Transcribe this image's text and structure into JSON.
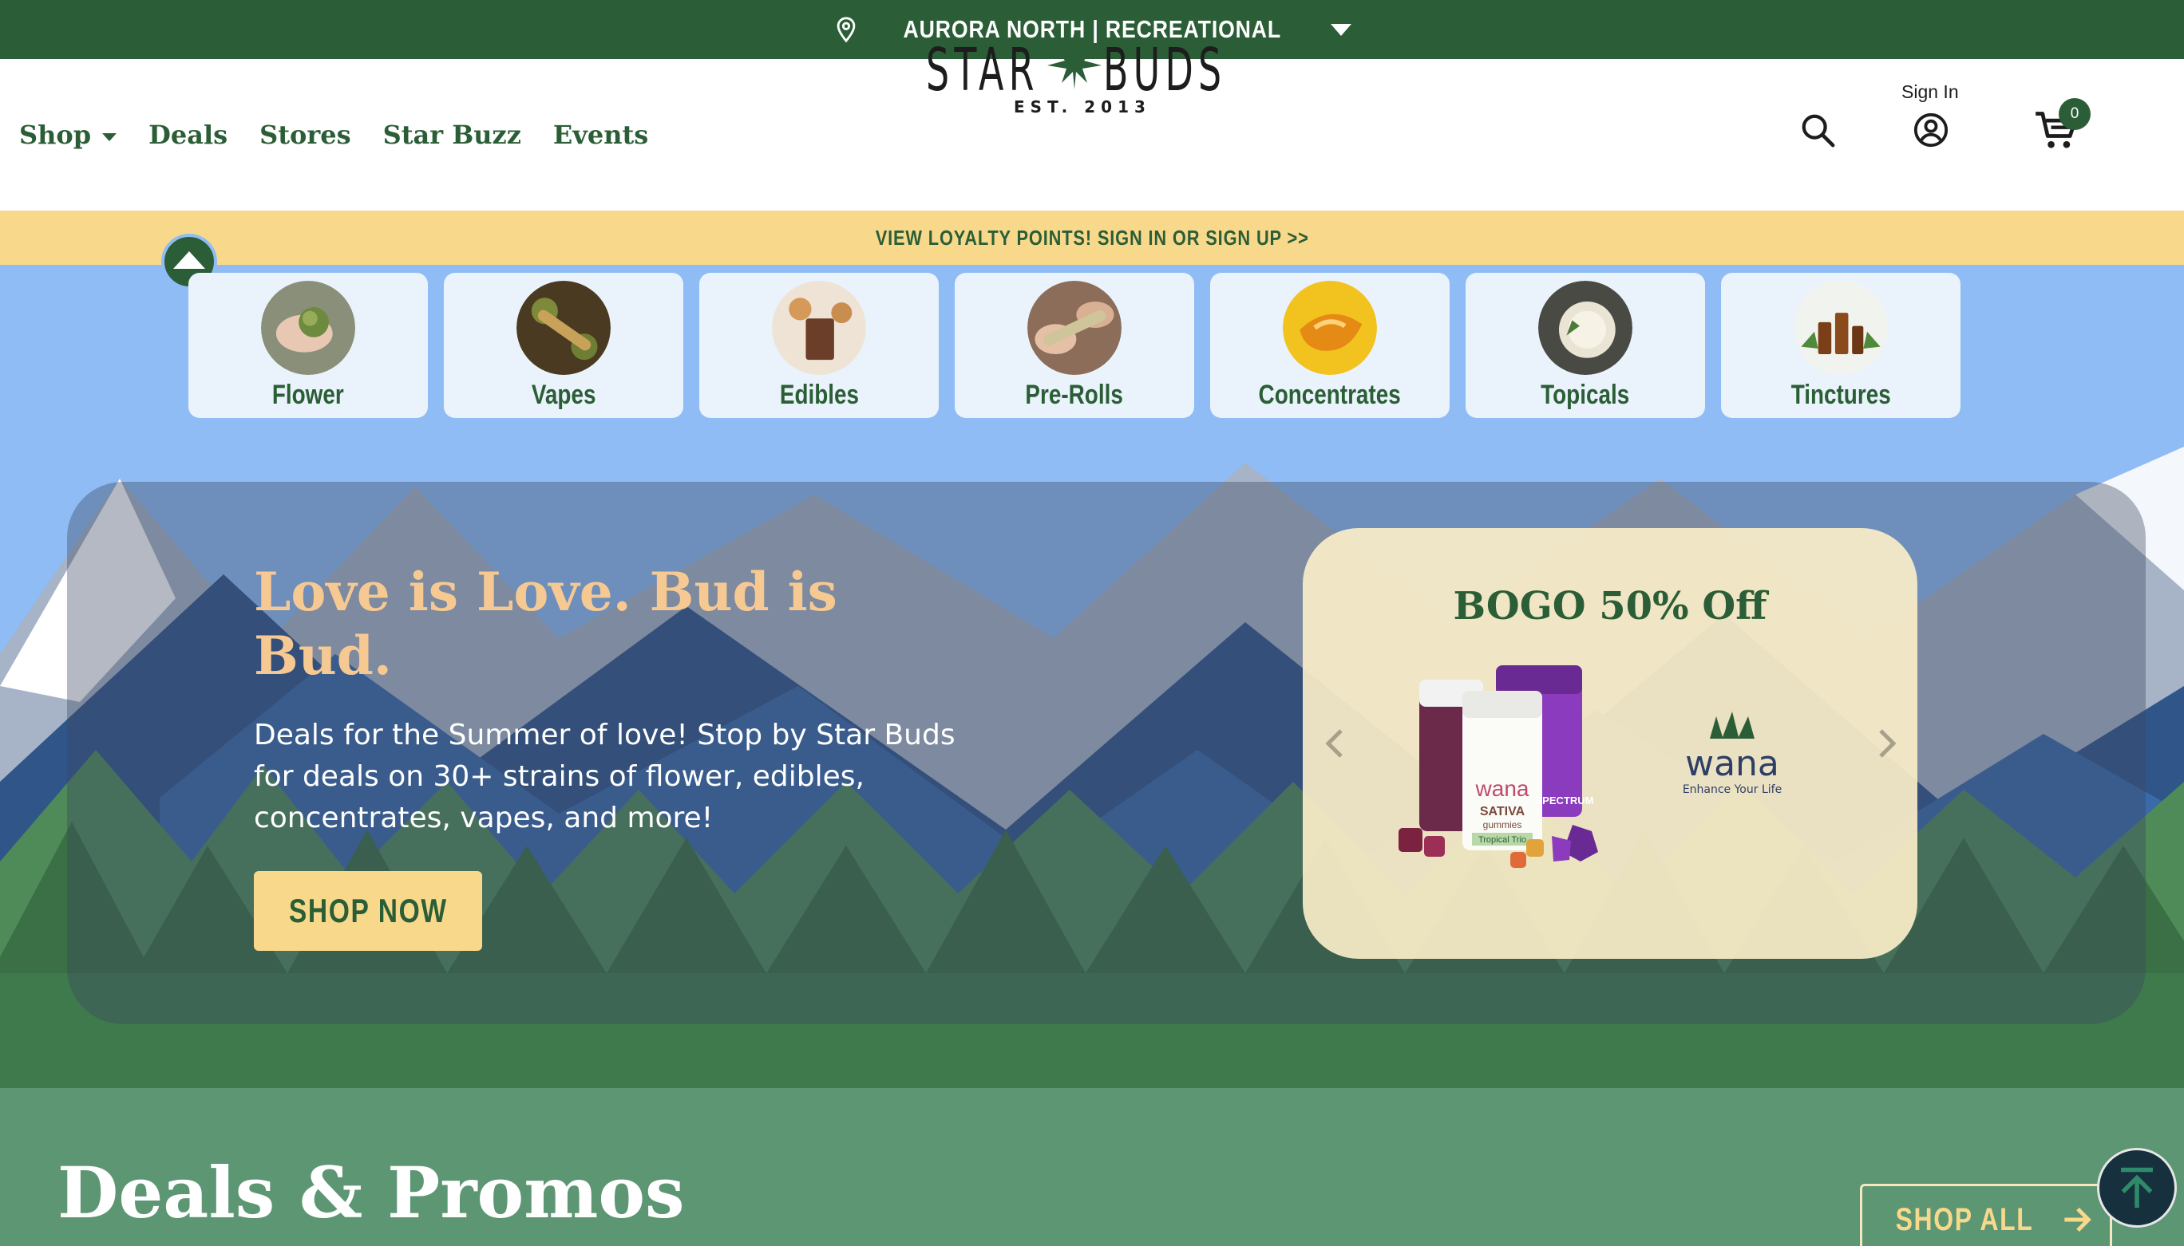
{
  "topbar": {
    "location": "AURORA NORTH | RECREATIONAL"
  },
  "nav": {
    "items": [
      {
        "label": "Shop",
        "dropdown": true
      },
      {
        "label": "Deals"
      },
      {
        "label": "Stores"
      },
      {
        "label": "Star Buzz"
      },
      {
        "label": "Events"
      }
    ]
  },
  "logo": {
    "word_left": "STAR",
    "word_right": "BUDS",
    "established": "EST. 2013"
  },
  "account": {
    "sign_in_label": "Sign In",
    "cart_count": "0"
  },
  "loyalty": {
    "text": "VIEW LOYALTY POINTS! SIGN IN OR SIGN UP >>"
  },
  "categories": [
    {
      "label": "Flower",
      "icon": "flower-thumb"
    },
    {
      "label": "Vapes",
      "icon": "vape-thumb"
    },
    {
      "label": "Edibles",
      "icon": "edibles-thumb"
    },
    {
      "label": "Pre-Rolls",
      "icon": "preroll-thumb"
    },
    {
      "label": "Concentrates",
      "icon": "concentrates-thumb"
    },
    {
      "label": "Topicals",
      "icon": "topicals-thumb"
    },
    {
      "label": "Tinctures",
      "icon": "tinctures-thumb"
    }
  ],
  "hero": {
    "title": "Love is Love. Bud is Bud.",
    "description": "Deals for the Summer of love! Stop by Star Buds for deals on 30+ strains of flower, edibles, concentrates, vapes, and more!",
    "cta": "SHOP NOW"
  },
  "promo": {
    "title": "BOGO 50% Off",
    "brand": "wana",
    "brand_tagline": "Enhance Your Life",
    "product_labels": [
      "wana",
      "SATIVA",
      "gummies",
      "Tropical Trio",
      "SPECTRUM"
    ]
  },
  "deals": {
    "title": "Deals & Promos",
    "shop_all": "SHOP ALL"
  },
  "colors": {
    "brand_green": "#2b5e36",
    "accent_yellow": "#f8d98c",
    "sky_blue": "#8fbcf4",
    "hero_title": "#f6c993",
    "deals_green": "#5c9673"
  }
}
